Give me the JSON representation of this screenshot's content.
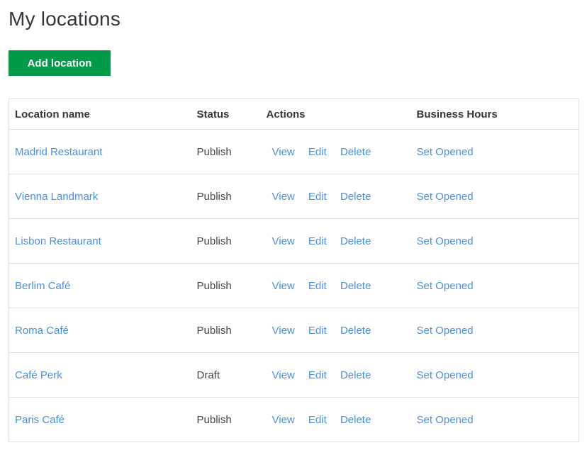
{
  "page": {
    "title": "My locations"
  },
  "toolbar": {
    "add_location_label": "Add location"
  },
  "colors": {
    "button_green": "#019a48",
    "link_blue": "#4a90e2",
    "heading_text": "#32373c",
    "body_text": "#43484e",
    "table_border": "#e1e1e1"
  },
  "table": {
    "headers": [
      "Location name",
      "Status",
      "Actions",
      "Business Hours"
    ],
    "action_labels": [
      "View",
      "Edit",
      "Delete"
    ],
    "business_hours_label": "Set Opened",
    "rows": [
      {
        "name": "Madrid Restaurant",
        "status": "Publish"
      },
      {
        "name": "Vienna Landmark",
        "status": "Publish"
      },
      {
        "name": "Lisbon Restaurant",
        "status": "Publish"
      },
      {
        "name": "Berlim Café",
        "status": "Publish"
      },
      {
        "name": "Roma Café",
        "status": "Publish"
      },
      {
        "name": "Café Perk",
        "status": "Draft"
      },
      {
        "name": "Paris Café",
        "status": "Publish"
      }
    ]
  }
}
